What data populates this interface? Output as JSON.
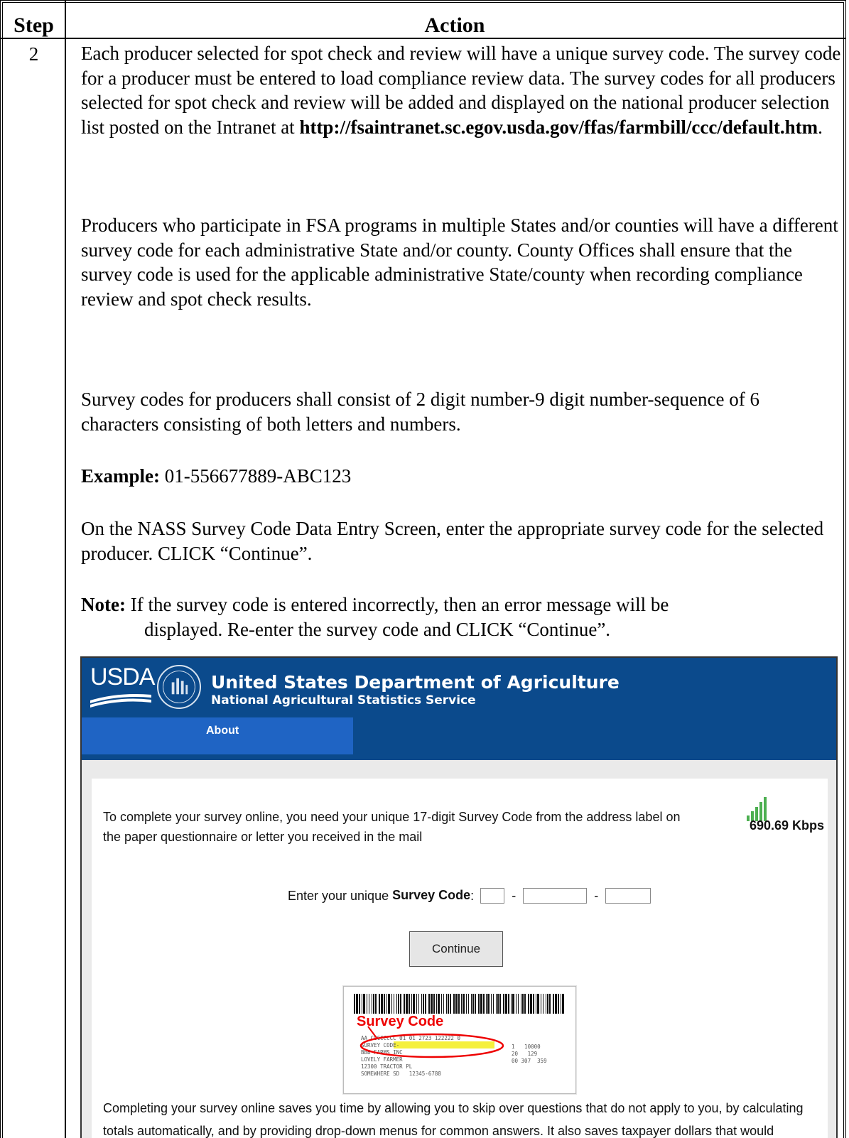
{
  "table": {
    "header_step": "Step",
    "header_action": "Action",
    "step_number": "2"
  },
  "paragraphs": {
    "p1_text": "Each producer selected for spot check and review will have a unique survey code. The survey code for a producer must be entered to load compliance review data.  The survey codes for all producers selected for spot check and review will be added and displayed on the national producer selection list posted on the Intranet at ",
    "p1_link": "http://fsaintranet.sc.egov.usda.gov/ffas/farmbill/ccc/default.htm",
    "p1_end": ".",
    "p2": "Producers who participate in FSA programs in multiple States and/or counties will have a different survey code for each administrative State and/or county.  County Offices shall ensure that the survey code is used for the applicable administrative State/county when recording compliance review and spot check results.",
    "p3": "Survey codes for producers shall consist of 2 digit number-9 digit number-sequence of 6 characters consisting of both letters and numbers.",
    "example_label": "Example:",
    "example_value": " 01-556677889-ABC123",
    "p5": "On the NASS Survey Code Data Entry Screen, enter the appropriate survey code for the selected producer.  CLICK “Continue”.",
    "note_label": "Note:",
    "note_line1": "  If the survey code is entered incorrectly, then an error message will be",
    "note_line2": "displayed.  Re-enter the survey code and CLICK “Continue”."
  },
  "screenshot": {
    "logo_text": "USDA",
    "department": "United States Department of Agriculture",
    "agency": "National Agricultural Statistics Service",
    "nav_about": "About",
    "intro": "To complete your survey online, you need your unique 17-digit Survey Code from the address label on the paper questionnaire or letter you received in the mail",
    "speed": "690.69 Kbps",
    "code_prompt": "Enter your unique ",
    "code_prompt_bold": "Survey Code",
    "code_prompt_colon": ":",
    "dash": "-",
    "continue_label": "Continue",
    "label_title": "Survey Code",
    "label_lines": "AA CCCCCCCC 01 01 2723 122222 0\nSURVEY CODE-\nBBB FARMS INC\nLOVELY FARMER\n12300 TRACTOR PL\nSOMEWHERE SD   12345-6788",
    "label_right": "1   10000\n20   129\n00 307  359",
    "outro": "Completing your survey online saves you time by allowing you to skip over questions that do not apply to you, by calculating totals automatically, and by providing drop-down menus for common answers. It also saves taxpayer dollars that would otherwise be spent on return postage and data entry."
  },
  "colors": {
    "header_blue": "#0b4a8c",
    "nav_tab_blue": "#1f64c4",
    "signal_green": "#4caf50",
    "label_red": "#e00000",
    "highlight_yellow": "#f5f03c"
  }
}
